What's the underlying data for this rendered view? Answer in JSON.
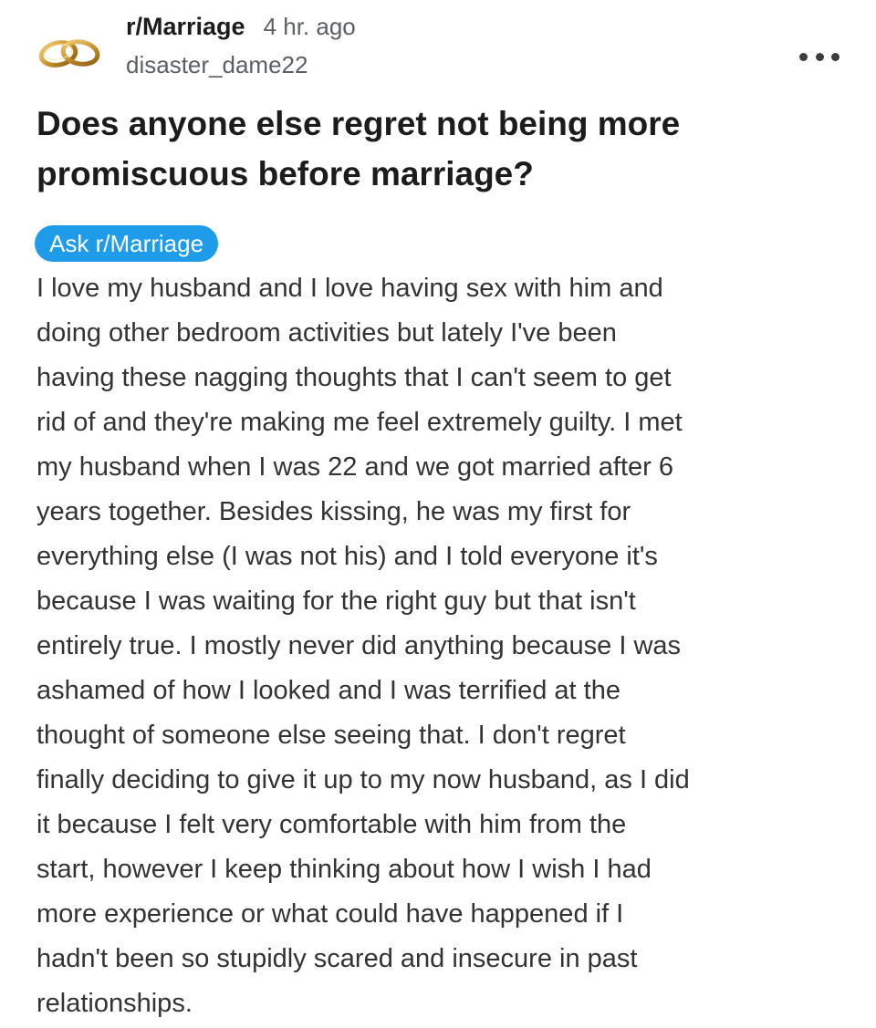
{
  "post": {
    "subreddit": "r/Marriage",
    "time_ago": "4 hr. ago",
    "username": "disaster_dame22",
    "avatar_icon": "wedding-rings-icon",
    "more_icon": "more-options-icon",
    "title_lines": [
      "Does anyone else regret not being more",
      "promiscuous before marriage?"
    ],
    "flair": "Ask r/Marriage",
    "flair_color": "#1e9be9",
    "body_lines": [
      "I love my husband and I love having sex with him and",
      "doing other bedroom activities but lately I've been",
      "having these nagging thoughts that I can't seem to get",
      "rid of and they're making me feel extremely guilty. I met",
      "my husband when I was 22 and we got married after 6",
      "years together. Besides kissing, he was my first for",
      "everything else (I was not his) and I told everyone it's",
      "because I was waiting for the right guy but that isn't",
      "entirely true. I mostly never did anything because I was",
      "ashamed of how I looked and I was terrified at the",
      "thought of someone else seeing that. I don't regret",
      "finally deciding to give it up to my now husband, as I did",
      "it because I felt very comfortable with him from the",
      "start, however I keep thinking about how I wish I had",
      "more experience or what could have happened if I",
      "hadn't been so stupidly scared and insecure in past",
      "relationships."
    ]
  }
}
